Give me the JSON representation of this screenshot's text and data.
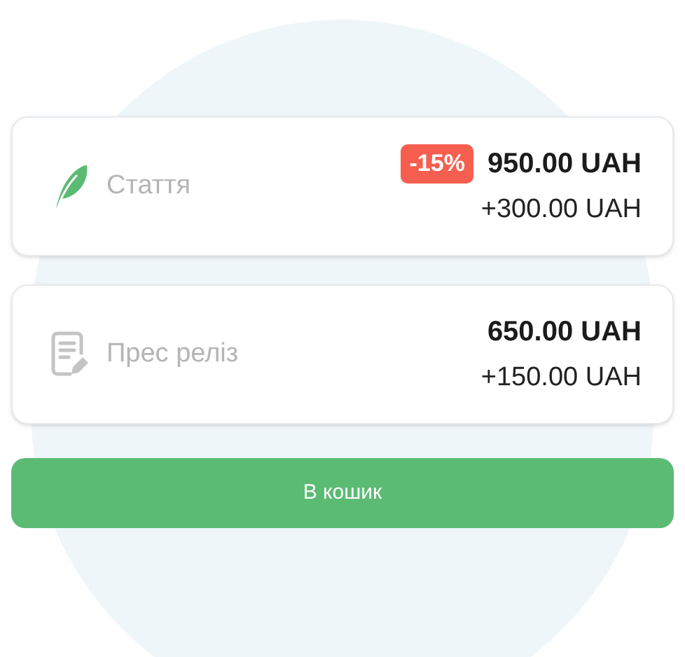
{
  "options": [
    {
      "kind": "feather",
      "selected": true,
      "label": "Стаття",
      "discount": "-15%",
      "price": "950.00 UAH",
      "extra": "+300.00 UAH"
    },
    {
      "kind": "document",
      "selected": false,
      "label": "Прес реліз",
      "price": "650.00 UAH",
      "extra": "+150.00 UAH"
    }
  ],
  "button": "В кошик"
}
